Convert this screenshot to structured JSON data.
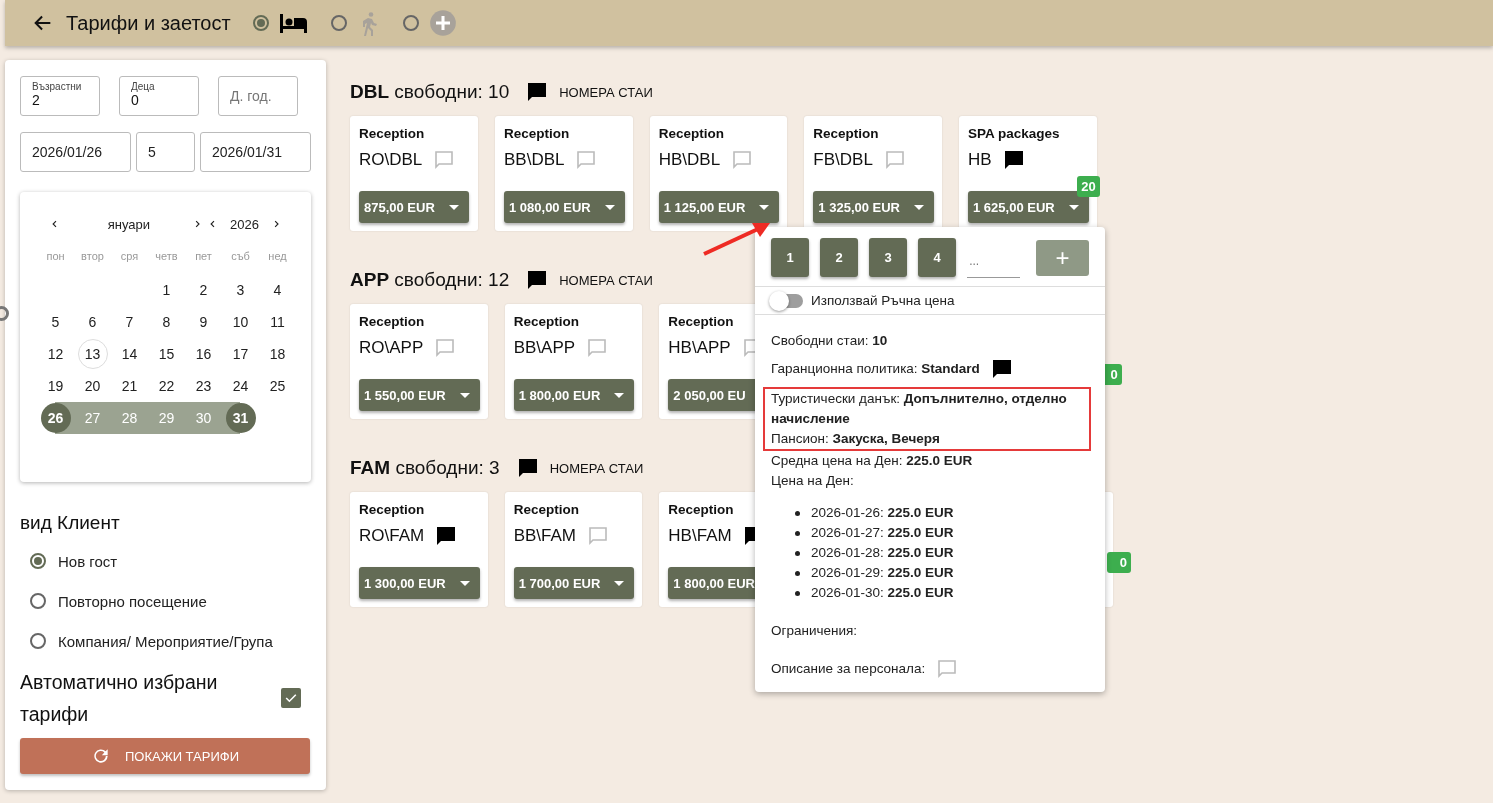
{
  "header": {
    "title": "Тарифи и заетост",
    "modes": [
      {
        "kind": "bed",
        "selected": true,
        "disabled": false
      },
      {
        "kind": "walk",
        "selected": false,
        "disabled": true
      },
      {
        "kind": "add",
        "selected": false,
        "disabled": true
      }
    ]
  },
  "filters": {
    "adults": {
      "label": "Възрастни",
      "value": "2"
    },
    "children": {
      "label": "Деца",
      "value": "0"
    },
    "birth_year": {
      "placeholder": "Д. год."
    },
    "date_from": "2026/01/26",
    "nights": "5",
    "date_to": "2026/01/31"
  },
  "calendar": {
    "month": "януари",
    "year": "2026",
    "weekdays": [
      "пон",
      "втор",
      "сря",
      "четв",
      "пет",
      "съб",
      "нед"
    ],
    "weeks": [
      [
        {
          "kind": "blank"
        },
        {
          "kind": "blank"
        },
        {
          "kind": "blank"
        },
        {
          "day": "1",
          "kind": "normal"
        },
        {
          "day": "2",
          "kind": "normal"
        },
        {
          "day": "3",
          "kind": "normal"
        },
        {
          "day": "4",
          "kind": "normal"
        }
      ],
      [
        {
          "day": "5",
          "kind": "normal"
        },
        {
          "day": "6",
          "kind": "normal"
        },
        {
          "day": "7",
          "kind": "normal"
        },
        {
          "day": "8",
          "kind": "normal"
        },
        {
          "day": "9",
          "kind": "normal"
        },
        {
          "day": "10",
          "kind": "normal"
        },
        {
          "day": "11",
          "kind": "normal"
        }
      ],
      [
        {
          "day": "12",
          "kind": "normal"
        },
        {
          "day": "13",
          "kind": "today"
        },
        {
          "day": "14",
          "kind": "normal"
        },
        {
          "day": "15",
          "kind": "normal"
        },
        {
          "day": "16",
          "kind": "normal"
        },
        {
          "day": "17",
          "kind": "normal"
        },
        {
          "day": "18",
          "kind": "normal"
        }
      ],
      [
        {
          "day": "19",
          "kind": "normal"
        },
        {
          "day": "20",
          "kind": "normal"
        },
        {
          "day": "21",
          "kind": "normal"
        },
        {
          "day": "22",
          "kind": "normal"
        },
        {
          "day": "23",
          "kind": "normal"
        },
        {
          "day": "24",
          "kind": "normal"
        },
        {
          "day": "25",
          "kind": "normal"
        }
      ],
      [
        {
          "day": "26",
          "kind": "range-start"
        },
        {
          "day": "27",
          "kind": "in-range"
        },
        {
          "day": "28",
          "kind": "in-range"
        },
        {
          "day": "29",
          "kind": "in-range"
        },
        {
          "day": "30",
          "kind": "in-range"
        },
        {
          "day": "31",
          "kind": "range-end"
        }
      ]
    ]
  },
  "client_type": {
    "title": "вид Клиент",
    "options": [
      {
        "label": "Нов гост",
        "selected": true
      },
      {
        "label": "Повторно посещение",
        "selected": false
      },
      {
        "label": "Компания/ Мероприятие/Група",
        "selected": false
      }
    ]
  },
  "auto_rates": {
    "label": "Автоматично избрани тарифи",
    "checked": true
  },
  "show_button": "ПОКАЖИ ТАРИФИ",
  "room_types": [
    {
      "code": "DBL",
      "free_label": "свободни: 10",
      "note_filled": true,
      "rooms_link": "НОМЕРА СТАИ",
      "rates": [
        {
          "kind": "card",
          "source": "Reception",
          "name": "RO\\DBL",
          "note_filled": false,
          "price": "875,00 EUR"
        },
        {
          "kind": "card",
          "source": "Reception",
          "name": "BB\\DBL",
          "note_filled": false,
          "price": "1 080,00 EUR"
        },
        {
          "kind": "card",
          "source": "Reception",
          "name": "HB\\DBL",
          "note_filled": false,
          "price": "1 125,00 EUR"
        },
        {
          "kind": "card",
          "source": "Reception",
          "name": "FB\\DBL",
          "note_filled": false,
          "price": "1 325,00 EUR"
        },
        {
          "kind": "card",
          "source": "SPA packages",
          "name": "HB",
          "note_filled": true,
          "price": "1 625,00 EUR",
          "badge": "20"
        }
      ]
    },
    {
      "code": "APP",
      "free_label": "свободни: 12",
      "note_filled": true,
      "rooms_link": "НОМЕРА СТАИ",
      "rates": [
        {
          "kind": "card",
          "source": "Reception",
          "name": "RO\\APP",
          "note_filled": false,
          "price": "1 550,00 EUR"
        },
        {
          "kind": "card",
          "source": "Reception",
          "name": "BB\\APP",
          "note_filled": false,
          "price": "1 800,00 EUR"
        },
        {
          "kind": "card",
          "source": "Reception",
          "name": "HB\\APP",
          "note_filled": false,
          "price": "2 050,00 EU"
        },
        {
          "kind": "hidden"
        },
        {
          "kind": "hidden",
          "badge": "0"
        }
      ]
    },
    {
      "code": "FAM",
      "free_label": "свободни: 3",
      "note_filled": true,
      "rooms_link": "НОМЕРА СТАИ",
      "rates": [
        {
          "kind": "card",
          "source": "Reception",
          "name": "RO\\FAM",
          "note_filled": true,
          "price": "1 300,00 EUR"
        },
        {
          "kind": "card",
          "source": "Reception",
          "name": "BB\\FAM",
          "note_filled": false,
          "price": "1 700,00 EUR"
        },
        {
          "kind": "card",
          "source": "Reception",
          "name": "HB\\FAM",
          "note_filled": true,
          "price": "1 800,00 EUR"
        },
        {
          "kind": "hidden"
        },
        {
          "kind": "hidden",
          "badge": "0"
        }
      ]
    }
  ],
  "popup": {
    "room_buttons": [
      "1",
      "2",
      "3",
      "4"
    ],
    "count_placeholder": "...",
    "add_button": "+",
    "manual_price": {
      "label": "Използвай Ръчна цена",
      "on": false
    },
    "free_rooms": "Свободни стаи: **10**",
    "guarantee": "Гаранционна политика: **Standard**",
    "tourist_tax": "Туристически данък: **Допълнително, отделно начисление**",
    "board": "Пансион: **Закуска, Вечеря**",
    "average_price": "Средна цена на Ден: **225.0 EUR**",
    "daily_title": "Цена на Ден:",
    "daily_prices": [
      "2026-01-26: **225.0 EUR**",
      "2026-01-27: **225.0 EUR**",
      "2026-01-28: **225.0 EUR**",
      "2026-01-29: **225.0 EUR**",
      "2026-01-30: **225.0 EUR**"
    ],
    "restrictions": "Ограничения:",
    "staff_description": "Описание за персонала:",
    "guarantee_note_filled": true,
    "staff_note_filled": false
  }
}
